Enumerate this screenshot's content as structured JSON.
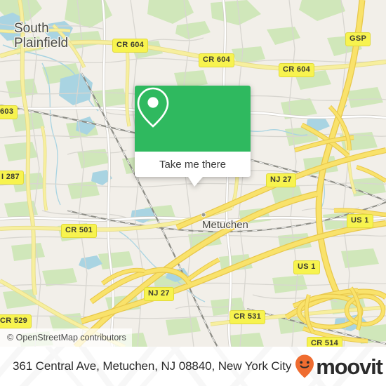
{
  "map": {
    "attribution": "© OpenStreetMap contributors",
    "place_labels": [
      {
        "name": "South Plainfield",
        "line1": "South",
        "line2": "Plainfield"
      },
      {
        "name": "Metuchen",
        "line1": "Metuchen"
      }
    ],
    "road_shields": [
      {
        "label": "CR 604"
      },
      {
        "label": "CR 604"
      },
      {
        "label": "GSP"
      },
      {
        "label": "603"
      },
      {
        "label": "I 287"
      },
      {
        "label": "NJ 27"
      },
      {
        "label": "US 1"
      },
      {
        "label": "CR 501"
      },
      {
        "label": "US 1"
      },
      {
        "label": "NJ 27"
      },
      {
        "label": "CR 531"
      },
      {
        "label": "CR 529"
      },
      {
        "label": "CR 514"
      }
    ],
    "colors": {
      "land": "#f2efe9",
      "water": "#aad3df",
      "green": "#cde6b4",
      "motorway": "#f7e06e",
      "trunk": "#f9d98a",
      "shield_fill": "#f7f34f",
      "shield_border": "#e0d93c"
    }
  },
  "callout": {
    "icon": "map-pin-icon",
    "button_label": "Take me there",
    "accent_color": "#2fb95f"
  },
  "bottom_bar": {
    "address": "361 Central Ave, Metuchen, NJ 08840, New York City",
    "brand_name": "moovit",
    "brand_icon": "moovit-pin-icon",
    "brand_color": "#ef6c30"
  }
}
